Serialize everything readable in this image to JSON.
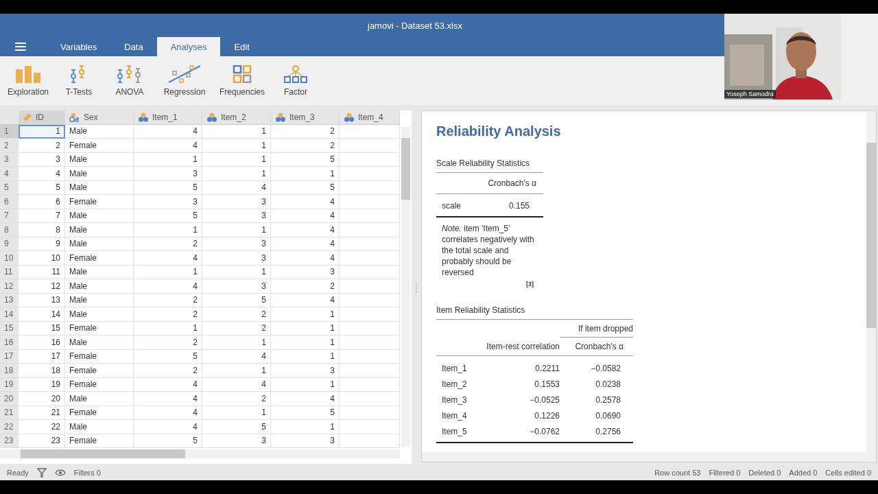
{
  "window": {
    "title": "jamovi - Dataset 53.xlsx"
  },
  "tabs": [
    {
      "label": "Variables",
      "selected": false
    },
    {
      "label": "Data",
      "selected": false
    },
    {
      "label": "Analyses",
      "selected": true
    },
    {
      "label": "Edit",
      "selected": false
    }
  ],
  "ribbon": [
    "Exploration",
    "T-Tests",
    "ANOVA",
    "Regression",
    "Frequencies",
    "Factor"
  ],
  "table": {
    "columns": [
      {
        "label": "ID",
        "kind": "id"
      },
      {
        "label": "Sex",
        "kind": "nominal"
      },
      {
        "label": "Item_1",
        "kind": "ordinal"
      },
      {
        "label": "Item_2",
        "kind": "ordinal"
      },
      {
        "label": "Item_3",
        "kind": "ordinal"
      },
      {
        "label": "Item_4",
        "kind": "ordinal"
      }
    ],
    "rows": [
      {
        "n": "1",
        "cells": [
          "1",
          "Male",
          "4",
          "1",
          "2"
        ],
        "selected": true
      },
      {
        "n": "2",
        "cells": [
          "2",
          "Female",
          "4",
          "1",
          "2"
        ],
        "selected": false
      },
      {
        "n": "3",
        "cells": [
          "3",
          "Male",
          "1",
          "1",
          "5"
        ],
        "selected": false
      },
      {
        "n": "4",
        "cells": [
          "4",
          "Male",
          "3",
          "1",
          "1"
        ],
        "selected": false
      },
      {
        "n": "5",
        "cells": [
          "5",
          "Male",
          "5",
          "4",
          "5"
        ],
        "selected": false
      },
      {
        "n": "6",
        "cells": [
          "6",
          "Female",
          "3",
          "3",
          "4"
        ],
        "selected": false
      },
      {
        "n": "7",
        "cells": [
          "7",
          "Male",
          "5",
          "3",
          "4"
        ],
        "selected": false
      },
      {
        "n": "8",
        "cells": [
          "8",
          "Male",
          "1",
          "1",
          "4"
        ],
        "selected": false
      },
      {
        "n": "9",
        "cells": [
          "9",
          "Male",
          "2",
          "3",
          "4"
        ],
        "selected": false
      },
      {
        "n": "10",
        "cells": [
          "10",
          "Female",
          "4",
          "3",
          "4"
        ],
        "selected": false
      },
      {
        "n": "11",
        "cells": [
          "11",
          "Male",
          "1",
          "1",
          "3"
        ],
        "selected": false
      },
      {
        "n": "12",
        "cells": [
          "12",
          "Male",
          "4",
          "3",
          "2"
        ],
        "selected": false
      },
      {
        "n": "13",
        "cells": [
          "13",
          "Male",
          "2",
          "5",
          "4"
        ],
        "selected": false
      },
      {
        "n": "14",
        "cells": [
          "14",
          "Male",
          "2",
          "2",
          "1"
        ],
        "selected": false
      },
      {
        "n": "15",
        "cells": [
          "15",
          "Female",
          "1",
          "2",
          "1"
        ],
        "selected": false
      },
      {
        "n": "16",
        "cells": [
          "16",
          "Male",
          "2",
          "1",
          "1"
        ],
        "selected": false
      },
      {
        "n": "17",
        "cells": [
          "17",
          "Female",
          "5",
          "4",
          "1"
        ],
        "selected": false
      },
      {
        "n": "18",
        "cells": [
          "18",
          "Female",
          "2",
          "1",
          "3"
        ],
        "selected": false
      },
      {
        "n": "19",
        "cells": [
          "19",
          "Female",
          "4",
          "4",
          "1"
        ],
        "selected": false
      },
      {
        "n": "20",
        "cells": [
          "20",
          "Male",
          "4",
          "2",
          "4"
        ],
        "selected": false
      },
      {
        "n": "21",
        "cells": [
          "21",
          "Female",
          "4",
          "1",
          "5"
        ],
        "selected": false
      },
      {
        "n": "22",
        "cells": [
          "22",
          "Male",
          "4",
          "5",
          "1"
        ],
        "selected": false
      },
      {
        "n": "23",
        "cells": [
          "23",
          "Female",
          "5",
          "3",
          "3"
        ],
        "selected": false
      }
    ]
  },
  "status_bar": {
    "ready": "Ready",
    "filters": "Filters 0",
    "counts": [
      "Row count 53",
      "Filtered 0",
      "Deleted 0",
      "Added 0",
      "Cells edited 0"
    ]
  },
  "results": {
    "title": "Reliability Analysis",
    "scale_table": {
      "title": "Scale Reliability Statistics",
      "header": "Cronbach's α",
      "label": "scale",
      "value": "0.155",
      "note": "*Note.* item 'Item_5' correlates negatively with the total scale and probably should be reversed",
      "ref": "[3]"
    },
    "item_table": {
      "title": "Item Reliability Statistics",
      "spanner": "If item dropped",
      "columns": [
        "Item-rest correlation",
        "Cronbach's α"
      ],
      "rows": [
        {
          "label": "Item_1",
          "values": [
            "0.2211",
            "−0.0582"
          ]
        },
        {
          "label": "Item_2",
          "values": [
            "0.1553",
            "0.0238"
          ]
        },
        {
          "label": "Item_3",
          "values": [
            "−0.0525",
            "0.2578"
          ]
        },
        {
          "label": "Item_4",
          "values": [
            "0.1226",
            "0.0690"
          ]
        },
        {
          "label": "Item_5",
          "values": [
            "−0.0762",
            "0.2756"
          ]
        }
      ]
    }
  },
  "video": {
    "kind": "picture",
    "name": "Yoseph Samodra"
  }
}
